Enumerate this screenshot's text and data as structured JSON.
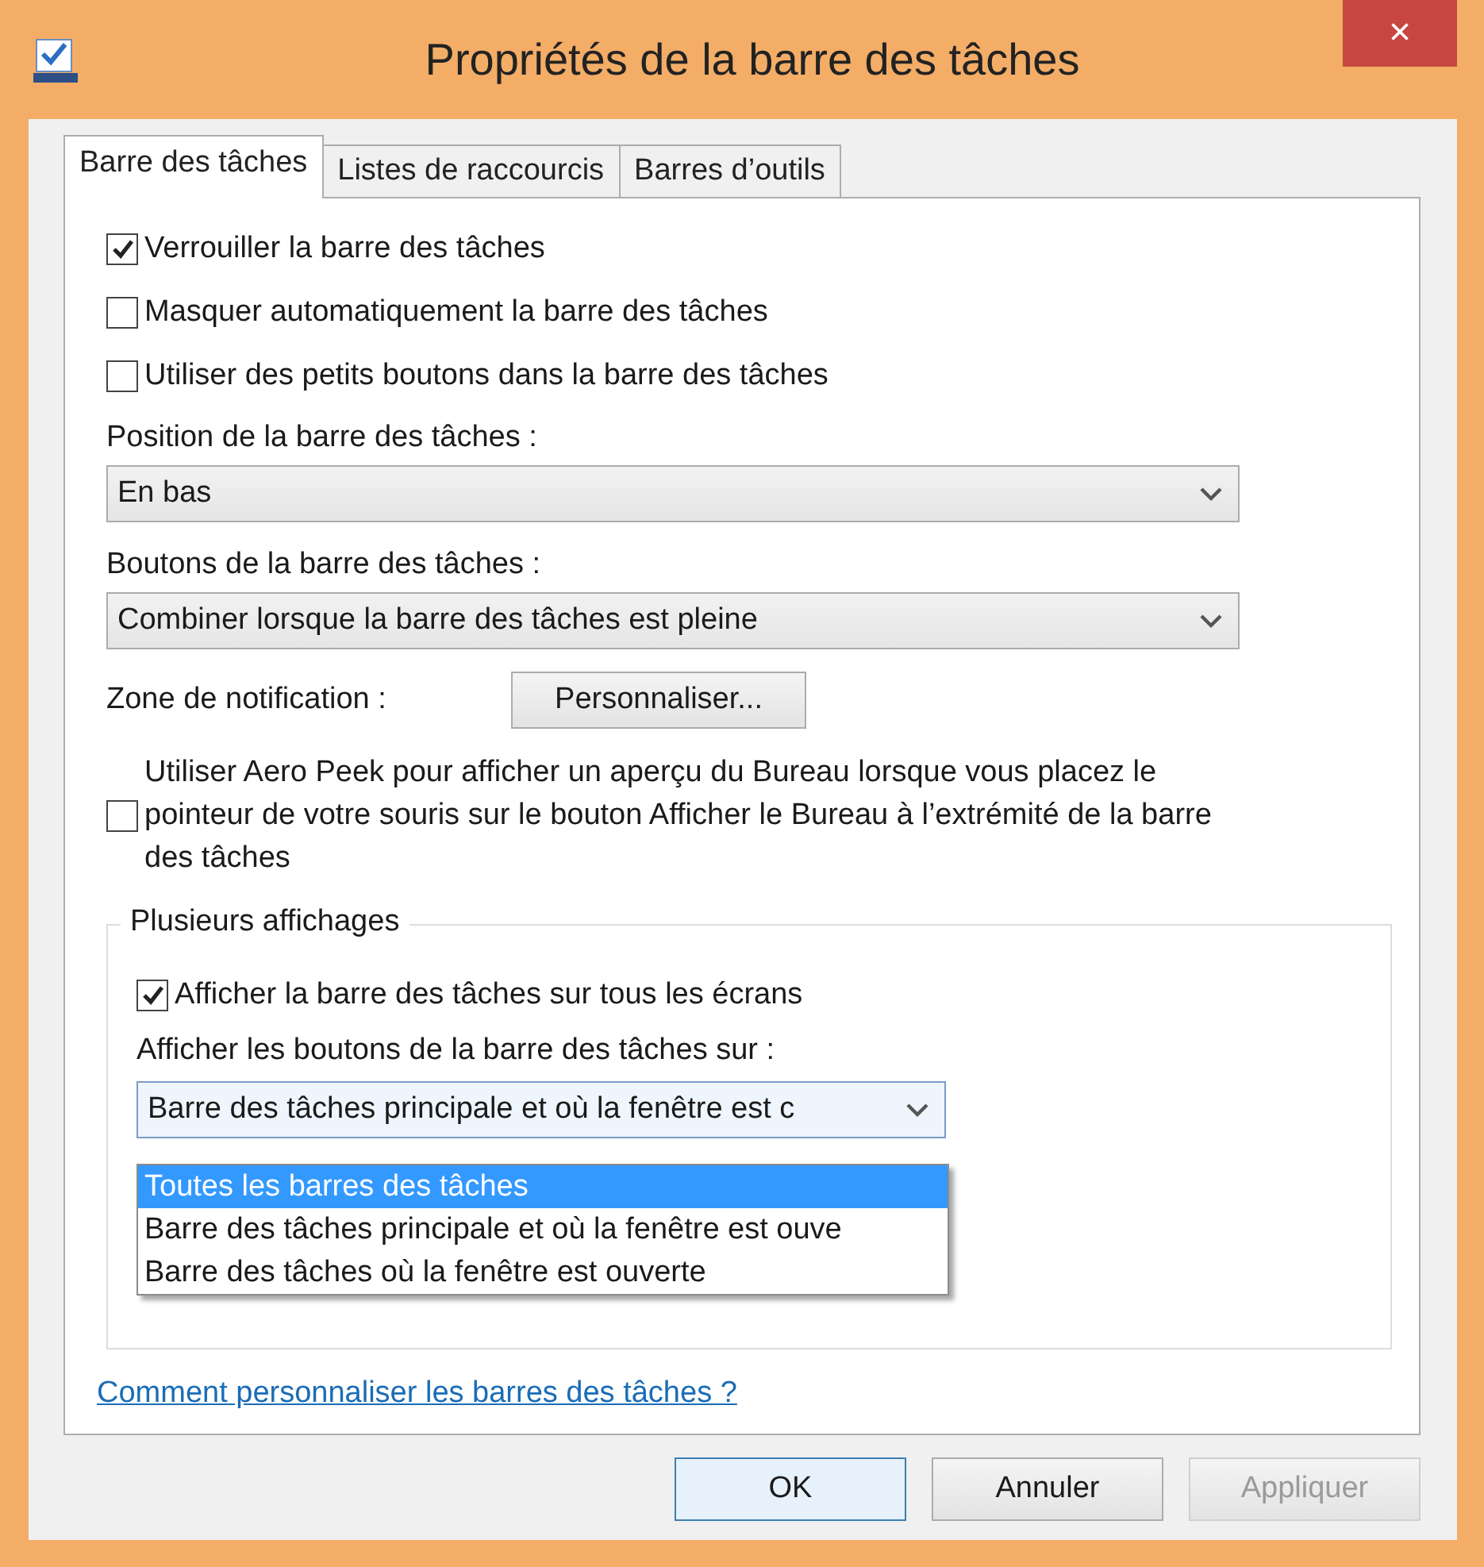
{
  "window": {
    "title": "Propriétés de la barre des tâches",
    "close": "×"
  },
  "tabs": [
    {
      "label": "Barre des tâches",
      "selected": true
    },
    {
      "label": "Listes de raccourcis",
      "selected": false
    },
    {
      "label": "Barres d’outils",
      "selected": false
    }
  ],
  "checkboxes": [
    {
      "label": "Verrouiller la barre des tâches",
      "checked": true
    },
    {
      "label": "Masquer automatiquement la barre des tâches",
      "checked": false
    },
    {
      "label": "Utiliser des petits boutons dans la barre des tâches",
      "checked": false
    }
  ],
  "position": {
    "label": "Position de la barre des tâches :",
    "value": "En bas"
  },
  "taskbar_buttons": {
    "label": "Boutons de la barre des tâches :",
    "value": "Combiner lorsque la barre des tâches est pleine"
  },
  "notification_area": {
    "label": "Zone de notification :",
    "button": "Personnaliser..."
  },
  "aero_peek": {
    "label": "Utiliser Aero Peek pour afficher un aperçu du Bureau lorsque vous placez le pointeur de votre souris sur le bouton Afficher le Bureau à l’extrémité de la barre des tâches",
    "checked": false
  },
  "multiple_displays": {
    "legend": "Plusieurs affichages",
    "show_all": {
      "label": "Afficher la barre des tâches sur tous les écrans",
      "checked": true
    },
    "buttons_on": {
      "label": "Afficher les boutons de la barre des tâches sur :",
      "value": "Barre des tâches principale et où la fenêtre est c",
      "options": [
        {
          "label": "Toutes les barres des tâches",
          "selected": true
        },
        {
          "label": "Barre des tâches principale et où la fenêtre est ouve",
          "selected": false
        },
        {
          "label": "Barre des tâches où la fenêtre est ouverte",
          "selected": false
        }
      ]
    }
  },
  "help_link": "Comment personnaliser les barres des tâches ?",
  "buttons": [
    {
      "label": "OK",
      "kind": "default",
      "disabled": false
    },
    {
      "label": "Annuler",
      "kind": "normal",
      "disabled": false
    },
    {
      "label": "Appliquer",
      "kind": "normal",
      "disabled": true
    }
  ]
}
